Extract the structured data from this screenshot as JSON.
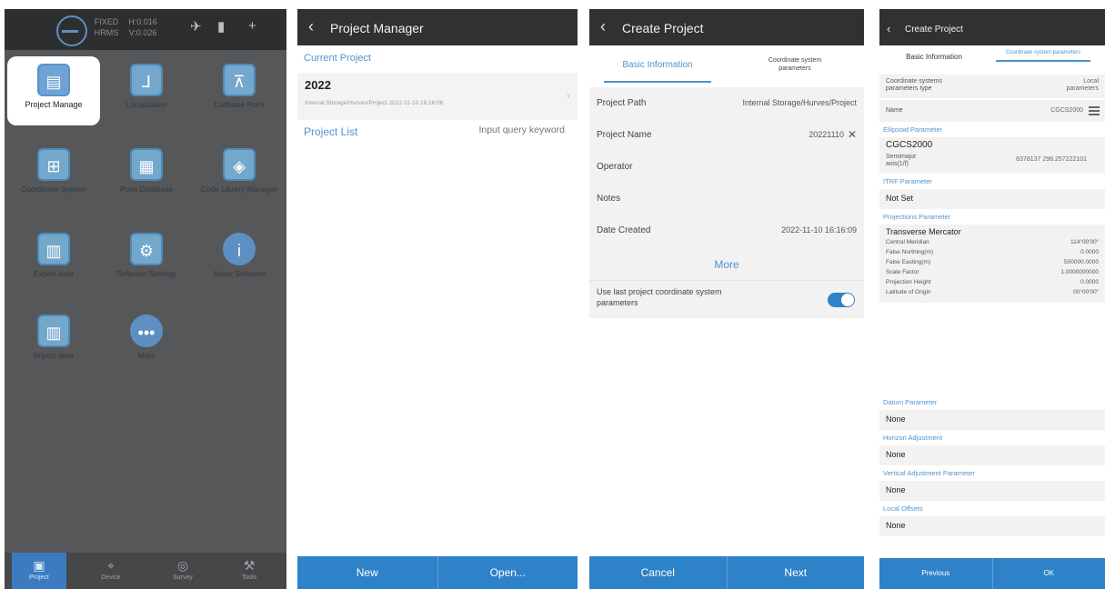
{
  "screen1": {
    "status": {
      "stat_a": "FIXED",
      "stat_a_sub": "HRMS",
      "stat_b": "H:0.016",
      "stat_b_sub": "V:0.026"
    },
    "grid": [
      {
        "label": "Project Manage",
        "icon": "clipboard-icon"
      },
      {
        "label": "Localization",
        "icon": "axis-icon"
      },
      {
        "label": "Calibrate Point",
        "icon": "calibrate-icon"
      },
      {
        "label": "Coordinate System",
        "icon": "globe-grid-icon"
      },
      {
        "label": "Point Database",
        "icon": "database-grid-icon"
      },
      {
        "label": "Code Library Manager",
        "icon": "layers-icon"
      },
      {
        "label": "Export data",
        "icon": "chart-export-icon"
      },
      {
        "label": "Software Settings",
        "icon": "settings-icon"
      },
      {
        "label": "About Software",
        "icon": "info-icon"
      },
      {
        "label": "Import data",
        "icon": "chart-import-icon"
      },
      {
        "label": "More",
        "icon": "more-icon"
      }
    ],
    "bottom_nav": [
      {
        "label": "Project",
        "icon": "project-icon"
      },
      {
        "label": "Device",
        "icon": "device-icon"
      },
      {
        "label": "Survey",
        "icon": "survey-icon"
      },
      {
        "label": "Tools",
        "icon": "tools-icon"
      }
    ]
  },
  "screen2": {
    "title": "Project Manager",
    "current_label": "Current Project",
    "project_name": "2022",
    "project_path": "Internal Storage/Hurves/Project  2022-11-10 16:16:06",
    "list_label": "Project List",
    "search_placeholder": "Input query keyword",
    "buttons": {
      "new": "New",
      "open": "Open..."
    }
  },
  "screen3": {
    "title": "Create Project",
    "tab_basic": "Basic Information",
    "tab_coord": "Coordinate system parameters",
    "fields": [
      {
        "label": "Project Path",
        "value": "Internal Storage/Hurves/Project"
      },
      {
        "label": "Project Name",
        "value": "20221110"
      },
      {
        "label": "Operator",
        "value": ""
      },
      {
        "label": "Notes",
        "value": ""
      },
      {
        "label": "Date Created",
        "value": "2022-11-10 16:16:09"
      }
    ],
    "more": "More",
    "toggle_label": "Use last project coordinate system parameters",
    "toggle_on": true,
    "buttons": {
      "cancel": "Cancel",
      "next": "Next"
    }
  },
  "screen4": {
    "title": "Create Project",
    "tab_basic": "Basic Information",
    "tab_coord": "Coordinate system parameters",
    "type_label": "Coordinate systems parameters type",
    "type_value": "Local parameters",
    "name_label": "Name",
    "name_value": "CGCS2000",
    "ellipsoid_section": "Ellipsoid Parameter",
    "ellipsoid_name": "CGCS2000",
    "ellipsoid_kv_label": "Semimajor axis(1/f)",
    "ellipsoid_kv_value": "6378137 298.257222101",
    "itrf_section": "ITRF Parameter",
    "itrf_value": "Not Set",
    "projection_section": "Projections Parameter",
    "projection_name": "Transverse Mercator",
    "projection_params": [
      {
        "k": "Central Meridian",
        "v": "114°00'00\""
      },
      {
        "k": "False Northing(m)",
        "v": "0.0000"
      },
      {
        "k": "False Easting(m)",
        "v": "500000.0000"
      },
      {
        "k": "Scale Factor",
        "v": "1.0000000000"
      },
      {
        "k": "Projection Height",
        "v": "0.0000"
      },
      {
        "k": "Latitude of Origin",
        "v": "00°00'00\""
      }
    ],
    "datum_section": "Datum Parameter",
    "datum_value": "None",
    "horizon_section": "Horizon Adjustment",
    "horizon_value": "None",
    "vertical_section": "Vertical Adjustment Parameter",
    "vertical_value": "None",
    "local_section": "Local Offsets",
    "local_value": "None",
    "buttons": {
      "previous": "Previous",
      "ok": "OK"
    }
  },
  "colors": {
    "accent": "#4e93cf",
    "button_bar": "#2e82c7",
    "top_bar": "#2f3133"
  }
}
